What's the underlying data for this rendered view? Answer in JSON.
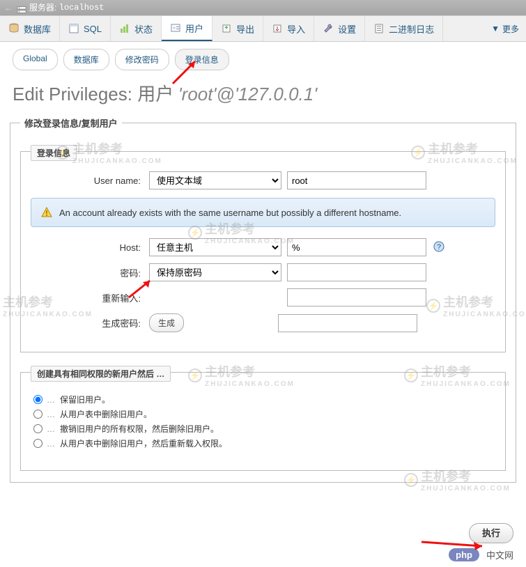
{
  "topbar": {
    "server_label": "服务器:",
    "server_name": "localhost"
  },
  "tabs": {
    "database": "数据库",
    "sql": "SQL",
    "status": "状态",
    "users": "用户",
    "export": "导出",
    "import": "导入",
    "settings": "设置",
    "binlog": "二进制日志",
    "more": "更多"
  },
  "subtabs": {
    "global": "Global",
    "database": "数据库",
    "changepw": "修改密码",
    "logininfo": "登录信息"
  },
  "heading_prefix": "Edit Privileges: ",
  "heading_userlabel": "用户",
  "heading_user": "'root'",
  "heading_at": "@",
  "heading_host": "'127.0.0.1'",
  "panel_legend": "修改登录信息/复制用户",
  "login_legend": "登录信息",
  "labels": {
    "username": "User name:",
    "host": "Host:",
    "password": "密码:",
    "retype": "重新输入:",
    "genpw": "生成密码:"
  },
  "fields": {
    "username_select": "使用文本域",
    "username_value": "root",
    "host_select": "任意主机",
    "host_value": "%",
    "password_select": "保持原密码",
    "password_value": "",
    "retype_value": "",
    "genpw_value": ""
  },
  "info_message": "An account already exists with the same username but possibly a different hostname.",
  "generate_btn": "生成",
  "create_legend": "创建具有相同权限的新用户然后 …",
  "radio_options": [
    "保留旧用户。",
    "从用户表中删除旧用户。",
    "撤销旧用户的所有权限，然后删除旧用户。",
    "从用户表中删除旧用户，然后重新载入权限。"
  ],
  "radio_selected_index": 0,
  "php_badge": "php",
  "cnw_text": "中文网",
  "exec_btn": "执行",
  "watermark_main": "主机参考",
  "watermark_sub": "ZHUJICANKAO.COM"
}
